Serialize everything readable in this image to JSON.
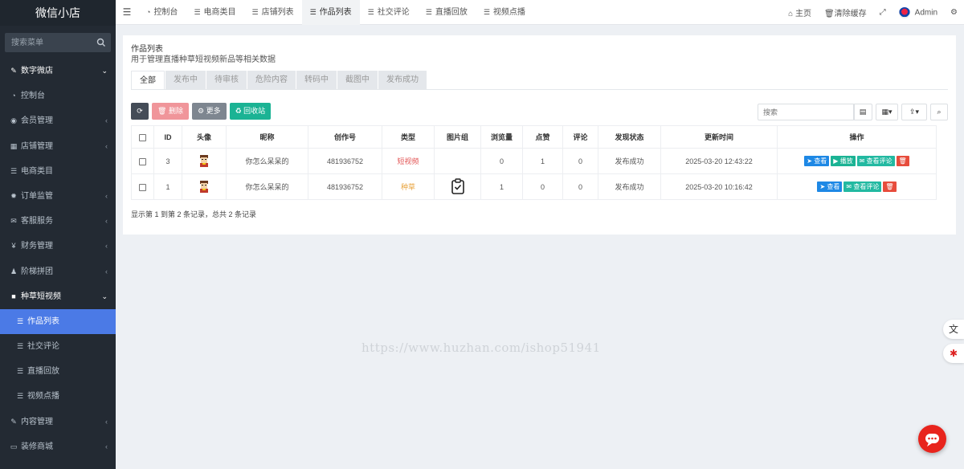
{
  "sidebar": {
    "logo": "微信小店",
    "search_placeholder": "搜索菜单",
    "items": [
      {
        "label": "数字微店",
        "icon": "✎",
        "kind": "group",
        "caret": "⌄"
      },
      {
        "label": "控制台",
        "icon": "◔",
        "kind": "item",
        "caret": ""
      },
      {
        "label": "会员管理",
        "icon": "◉",
        "kind": "item",
        "caret": "‹"
      },
      {
        "label": "店铺管理",
        "icon": "▦",
        "kind": "item",
        "caret": "‹"
      },
      {
        "label": "电商类目",
        "icon": "☰",
        "kind": "item",
        "caret": ""
      },
      {
        "label": "订单监管",
        "icon": "✹",
        "kind": "item",
        "caret": "‹"
      },
      {
        "label": "客服服务",
        "icon": "✉",
        "kind": "item",
        "caret": "‹"
      },
      {
        "label": "财务管理",
        "icon": "¥",
        "kind": "item",
        "caret": "‹"
      },
      {
        "label": "阶梯拼团",
        "icon": "♟",
        "kind": "item",
        "caret": "‹"
      },
      {
        "label": "种草短视频",
        "icon": "■",
        "kind": "group",
        "caret": "⌄"
      },
      {
        "label": "作品列表",
        "icon": "☰",
        "kind": "sub-active",
        "caret": ""
      },
      {
        "label": "社交评论",
        "icon": "☰",
        "kind": "sub",
        "caret": ""
      },
      {
        "label": "直播回放",
        "icon": "☰",
        "kind": "sub",
        "caret": ""
      },
      {
        "label": "视频点播",
        "icon": "☰",
        "kind": "sub",
        "caret": ""
      },
      {
        "label": "内容管理",
        "icon": "✎",
        "kind": "item",
        "caret": "‹"
      },
      {
        "label": "装修商城",
        "icon": "▭",
        "kind": "item",
        "caret": "‹"
      }
    ]
  },
  "topbar": {
    "toggle_icon": "☰",
    "tabs": [
      {
        "label": "控制台",
        "icon": "◔"
      },
      {
        "label": "电商类目",
        "icon": "☰"
      },
      {
        "label": "店铺列表",
        "icon": "☰"
      },
      {
        "label": "作品列表",
        "icon": "☰",
        "active": true
      },
      {
        "label": "社交评论",
        "icon": "☰"
      },
      {
        "label": "直播回放",
        "icon": "☰"
      },
      {
        "label": "视频点播",
        "icon": "☰"
      }
    ],
    "home": "主页",
    "clear_cache": "清除缓存",
    "user": "Admin"
  },
  "page": {
    "title": "作品列表",
    "description": "用于管理直播种草短视频新品等相关数据",
    "status_tabs": [
      "全部",
      "发布中",
      "待审核",
      "危险内容",
      "转码中",
      "截图中",
      "发布成功"
    ],
    "toolbar": {
      "delete": "删除",
      "more": "更多",
      "recycle": "回收站"
    },
    "search_placeholder": "搜索"
  },
  "table": {
    "columns": [
      "ID",
      "头像",
      "昵称",
      "创作号",
      "类型",
      "图片组",
      "浏览量",
      "点赞",
      "评论",
      "发现状态",
      "更新时间",
      "操作"
    ],
    "rows": [
      {
        "id": "3",
        "nickname": "你怎么呆呆的",
        "creator_no": "481936752",
        "type": "短视频",
        "type_color": "#e25353",
        "views": "0",
        "likes": "1",
        "comments": "0",
        "status": "发布成功",
        "updated": "2025-03-20 12:43:22",
        "actions": [
          "查看",
          "播放",
          "查看评论"
        ]
      },
      {
        "id": "1",
        "nickname": "你怎么呆呆的",
        "creator_no": "481936752",
        "type": "种草",
        "type_color": "#e8a33d",
        "views": "1",
        "likes": "0",
        "comments": "0",
        "status": "发布成功",
        "updated": "2025-03-20 10:16:42",
        "actions": [
          "查看",
          "查看评论"
        ]
      }
    ],
    "summary": "显示第 1 到第 2 条记录，总共 2 条记录"
  },
  "watermark": "https://www.huzhan.com/ishop51941"
}
